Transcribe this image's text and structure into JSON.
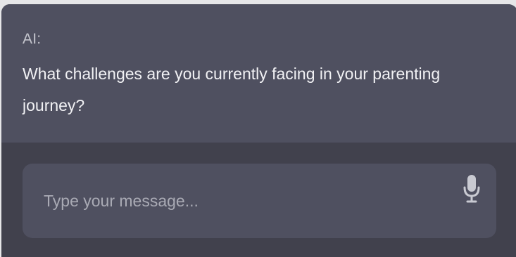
{
  "conversation": {
    "sender_label": "AI:",
    "message": "What challenges are you currently facing in your parenting journey?"
  },
  "composer": {
    "placeholder": "Type your message...",
    "value": "",
    "mic_icon": "microphone-icon"
  },
  "colors": {
    "message_background": "#4f5060",
    "panel_background": "#41414d",
    "text": "#f1f1f4",
    "placeholder": "#a9aab4",
    "icon": "#c9cad2"
  }
}
